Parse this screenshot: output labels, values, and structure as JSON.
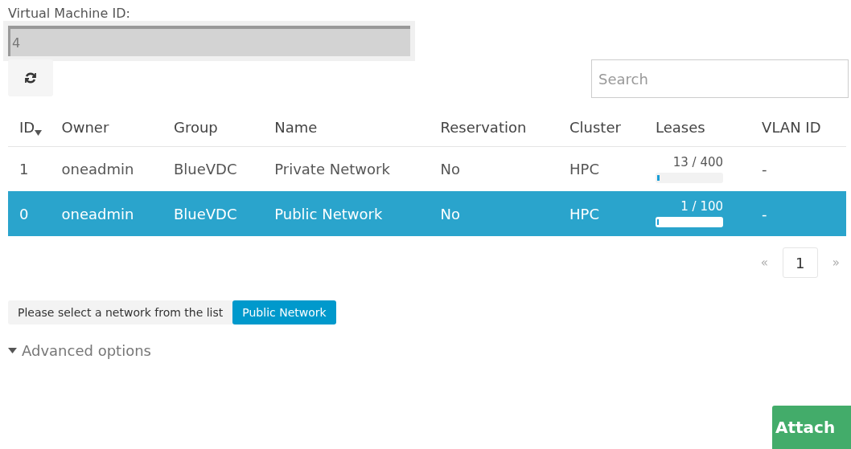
{
  "vm_id": {
    "label": "Virtual Machine ID:",
    "value": "4"
  },
  "search": {
    "placeholder": "Search"
  },
  "table": {
    "columns": [
      "ID",
      "Owner",
      "Group",
      "Name",
      "Reservation",
      "Cluster",
      "Leases",
      "VLAN ID"
    ],
    "rows": [
      {
        "id": "1",
        "owner": "oneadmin",
        "group": "BlueVDC",
        "name": "Private Network",
        "reservation": "No",
        "cluster": "HPC",
        "leases": "13 / 400",
        "level": 0.0325,
        "vlan": "-",
        "selected": false
      },
      {
        "id": "0",
        "owner": "oneadmin",
        "group": "BlueVDC",
        "name": "Public Network",
        "reservation": "No",
        "cluster": "HPC",
        "leases": "1 / 100",
        "level": 0.01,
        "vlan": "-",
        "selected": true
      }
    ]
  },
  "pagination": {
    "prev": "«",
    "pages": [
      {
        "label": "1",
        "selected": true
      }
    ],
    "next": "»"
  },
  "selection": {
    "hint": "Please select a network from the list",
    "chosen": "Public Network"
  },
  "advanced": {
    "label": "Advanced options"
  },
  "attach_button": "Attach"
}
